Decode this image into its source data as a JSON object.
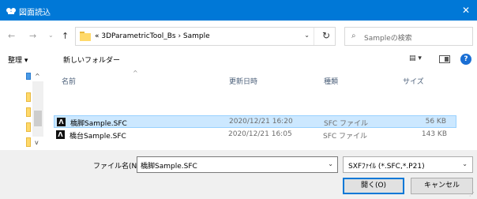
{
  "window": {
    "title": "図面読込",
    "close_glyph": "✕"
  },
  "nav": {
    "back_glyph": "←",
    "forward_glyph": "→",
    "recent_glyph": "⌄",
    "up_glyph": "↑",
    "path": "« 3DParametricTool_Bs › Sample",
    "address_dropdown_glyph": "⌄",
    "refresh_glyph": "↻",
    "search_icon_glyph": "⌕",
    "search_placeholder": "Sampleの検索"
  },
  "toolbar": {
    "organize": "整理 ▾",
    "new_folder": "新しいフォルダー",
    "view_icons": "▤ ▾",
    "help": "?"
  },
  "list": {
    "sort_arrow": "^",
    "columns": {
      "name": "名前",
      "date": "更新日時",
      "type": "種類",
      "size": "サイズ"
    },
    "rows": [
      {
        "icon": "Λ",
        "name": "橋脚Sample.SFC",
        "date": "2020/12/21 16:20",
        "type": "SFC ファイル",
        "size": "56 KB",
        "selected": true
      },
      {
        "icon": "Λ",
        "name": "橋台Sample.SFC",
        "date": "2020/12/21 16:05",
        "type": "SFC ファイル",
        "size": "143 KB",
        "selected": false
      }
    ]
  },
  "navpane": {
    "scroll_up_glyph": "^",
    "scroll_down_glyph": "v"
  },
  "bottom": {
    "filename_label": "ファイル名(N):",
    "filename_value": "橋脚Sample.SFC",
    "filename_dropdown_glyph": "⌄",
    "filter_value": "SXFﾌｧｲﾙ (*.SFC,*.P21)",
    "filter_dropdown_glyph": "⌄",
    "open_label": "開く(O)",
    "cancel_label": "キャンセル"
  },
  "colors": {
    "titlebar": "#0078d7",
    "selection": "#cce8ff",
    "accent": "#0078d7"
  }
}
